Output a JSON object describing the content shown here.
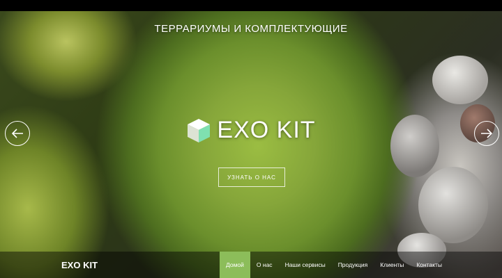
{
  "hero": {
    "title": "ТЕРРАРИУМЫ И КОМПЛЕКТУЮЩИЕ",
    "logo_text": "EXO KIT",
    "cta_label": "УЗНАТЬ О НАС",
    "prev_icon": "arrow-left-icon",
    "next_icon": "arrow-right-icon"
  },
  "navbar": {
    "brand": "EXO KIT",
    "items": [
      {
        "label": "Домой",
        "active": true
      },
      {
        "label": "О нас",
        "active": false
      },
      {
        "label": "Наши сервисы",
        "active": false
      },
      {
        "label": "Продукция",
        "active": false
      },
      {
        "label": "Клиенты",
        "active": false
      },
      {
        "label": "Контакты",
        "active": false
      }
    ]
  },
  "colors": {
    "accent": "#8cbd5a",
    "nav_bg": "rgba(0,0,0,0.45)",
    "text": "#ffffff"
  }
}
